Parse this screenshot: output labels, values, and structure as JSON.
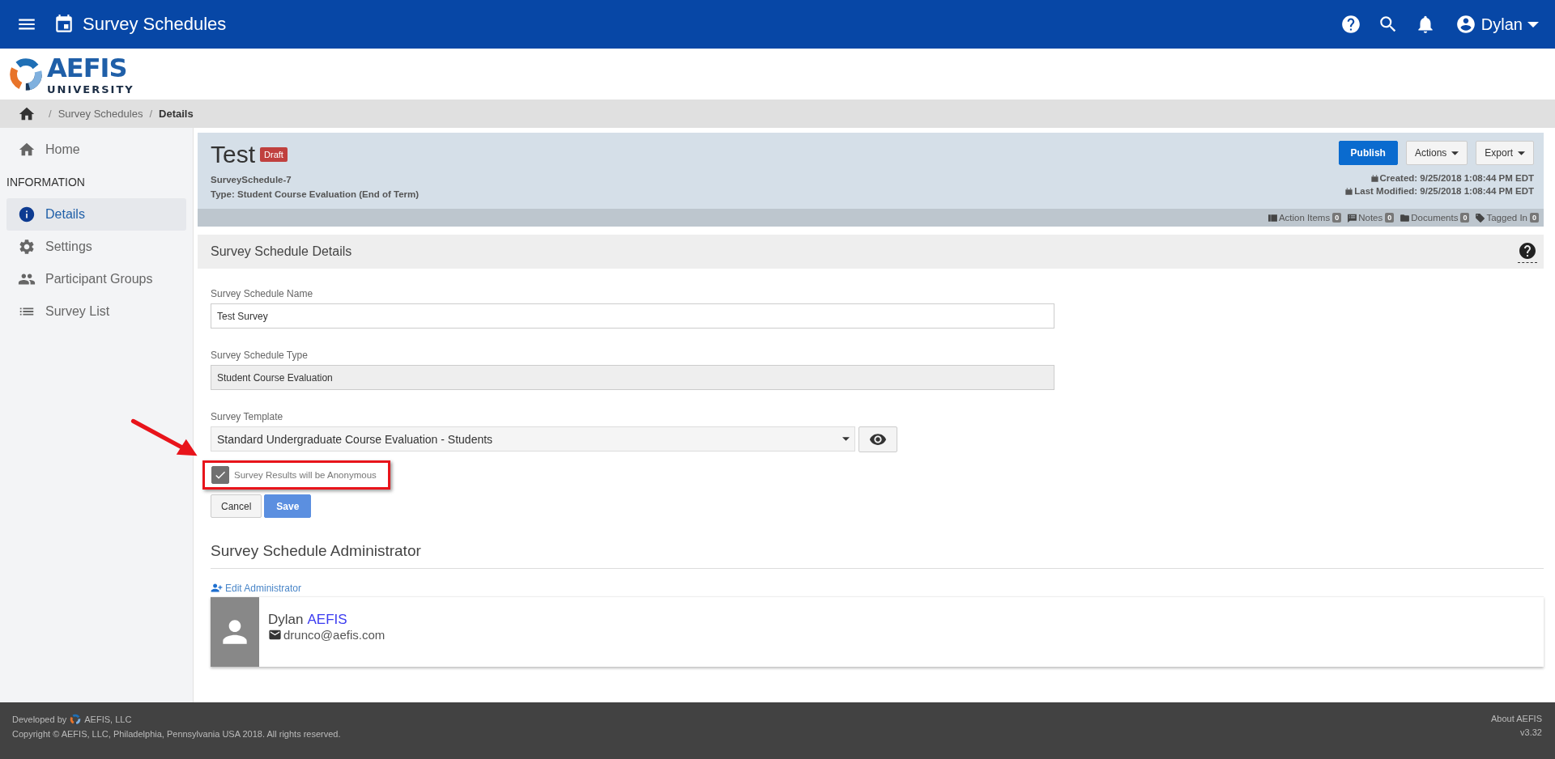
{
  "top_bar": {
    "title": "Survey Schedules",
    "user": "Dylan"
  },
  "logo": {
    "name": "AEFIS",
    "subtitle": "UNIVERSITY"
  },
  "breadcrumb": [
    {
      "separator": "/",
      "label": "Survey Schedules",
      "current": false
    },
    {
      "separator": "/",
      "label": "Details",
      "current": true
    }
  ],
  "sidebar": {
    "home": "Home",
    "section": "INFORMATION",
    "items": [
      {
        "label": "Details",
        "selected": true
      },
      {
        "label": "Settings",
        "selected": false
      },
      {
        "label": "Participant Groups",
        "selected": false
      },
      {
        "label": "Survey List",
        "selected": false
      }
    ]
  },
  "record": {
    "title": "Test",
    "status": "Draft",
    "id": "SurveySchedule-7",
    "type": "Type: Student Course Evaluation (End of Term)",
    "buttons": [
      {
        "label": "Publish",
        "kind": "primary"
      },
      {
        "label": "Actions",
        "kind": "dropdown"
      },
      {
        "label": "Export",
        "kind": "dropdown"
      }
    ],
    "created": "Created: 9/25/2018 1:08:44 PM EDT",
    "modified": "Last Modified: 9/25/2018 1:08:44 PM EDT",
    "counters": [
      {
        "label": "Action Items",
        "count": "0"
      },
      {
        "label": "Notes",
        "count": "0"
      },
      {
        "label": "Documents",
        "count": "0"
      },
      {
        "label": "Tagged In",
        "count": "0"
      }
    ]
  },
  "details": {
    "title": "Survey Schedule Details",
    "fields": [
      {
        "label": "Survey Schedule Name",
        "value": "Test Survey",
        "kind": "text"
      },
      {
        "label": "Survey Schedule Type",
        "value": "Student Course Evaluation",
        "kind": "readonly"
      },
      {
        "label": "Survey Template",
        "value": "Standard Undergraduate Course Evaluation - Students",
        "kind": "select"
      }
    ],
    "checkbox": {
      "label": "Survey Results will be Anonymous",
      "checked": true,
      "disabled": true
    },
    "buttons": [
      {
        "label": "Cancel",
        "kind": "default"
      },
      {
        "label": "Save",
        "kind": "primary"
      }
    ]
  },
  "administrator": {
    "title": "Survey Schedule Administrator",
    "edit_link": "Edit Administrator",
    "first_name": "Dylan",
    "last_name": "AEFIS",
    "email": "drunco@aefis.com"
  },
  "footer": {
    "developed_by": "Developed by",
    "company": "AEFIS, LLC",
    "copyright": "Copyright © AEFIS, LLC, Philadelphia, Pennsylvania USA 2018. All rights reserved.",
    "about": "About AEFIS",
    "version": "v3.32"
  }
}
